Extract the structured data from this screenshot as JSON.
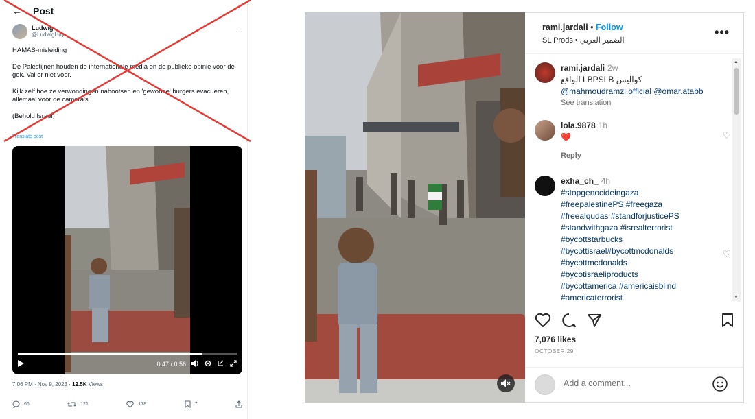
{
  "twitter": {
    "back_icon": "arrow-left-icon",
    "title": "Post",
    "author_name": "Ludwig",
    "author_handle": "@LudwigHuy...",
    "more_label": "···",
    "text": {
      "p1": "HAMAS-misleiding",
      "p2": "De Palestijnen houden de internationale media en de publieke opinie voor de gek. Val er niet voor.",
      "p3": "Kijk zelf hoe ze verwondingen nabootsen en 'gewonde' burgers evacueren, allemaal voor de camera's.",
      "p4": "(Behold Israel)"
    },
    "translate_label": "Translate post",
    "video": {
      "time": "0:47 / 0:56",
      "progress": 0.84
    },
    "meta_time": "7:06 PM · Nov 9, 2023 · ",
    "meta_views_count": "12.5K",
    "meta_views_label": " Views",
    "actions": {
      "replies": "66",
      "reposts": "121",
      "likes": "178",
      "bookmarks": "7"
    },
    "cross_color": "#e53935"
  },
  "instagram": {
    "header": {
      "username": "rami.jardali",
      "separator": " • ",
      "follow": "Follow",
      "subtitle": "SL Prods • الضمير العربي",
      "more": "•••"
    },
    "comments": [
      {
        "username": "rami.jardali",
        "time": "2w",
        "text": "الواقع LBPSLB كواليس",
        "mentions": "@mahmoudramzi.official @omar.atabb",
        "see_translation": "See translation"
      },
      {
        "username": "lola.9878",
        "time": "1h",
        "text": "❤️",
        "reply": "Reply"
      },
      {
        "username": "exha_ch_",
        "time": "4h",
        "hashtags": [
          "#stopgenocideingaza",
          "#freepalestinePS #freegaza",
          "#freealqudas #standforjusticePS",
          "#standwithgaza #isrealterrorist",
          "#bycottstarbucks",
          "#bycottisrael#bycottmcdonalds",
          "#bycottmcdonalds",
          "#bycotisraeliproducts",
          "#bycottamerica #americaisblind",
          "#americaterrorist"
        ]
      }
    ],
    "likes": "7,076 likes",
    "date": "OCTOBER 29",
    "add_comment_placeholder": "Add a comment...",
    "accent": "#0095f6"
  }
}
